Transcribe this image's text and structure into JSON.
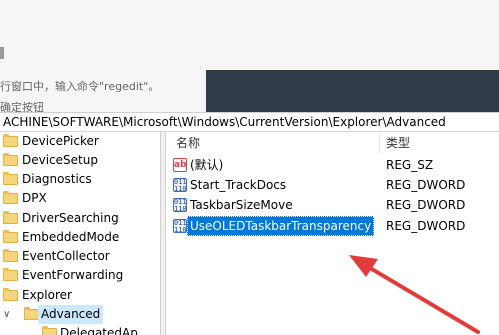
{
  "background": {
    "line1": "行窗口中，输入命令\"regedit\"。",
    "line2": "确定按钮"
  },
  "address_bar": {
    "path": "ACHINE\\SOFTWARE\\Microsoft\\Windows\\CurrentVersion\\Explorer\\Advanced"
  },
  "tree": {
    "items": [
      {
        "label": "DevicePicker"
      },
      {
        "label": "DeviceSetup"
      },
      {
        "label": "Diagnostics"
      },
      {
        "label": "DPX"
      },
      {
        "label": "DriverSearching"
      },
      {
        "label": "EmbeddedMode"
      },
      {
        "label": "EventCollector"
      },
      {
        "label": "EventForwarding"
      },
      {
        "label": "Explorer"
      }
    ],
    "selected": {
      "caret": "∨",
      "label": "Advanced"
    },
    "child": {
      "label": "DelegatedAp..."
    }
  },
  "list": {
    "headers": {
      "name": "名称",
      "type": "类型"
    },
    "rows": [
      {
        "icon": "string-value-icon",
        "icon_text": "ab",
        "name": "(默认)",
        "type": "REG_SZ"
      },
      {
        "icon": "dword-value-icon",
        "icon_text": "011\n110",
        "name": "Start_TrackDocs",
        "type": "REG_DWORD"
      },
      {
        "icon": "dword-value-icon",
        "icon_text": "011\n110",
        "name": "TaskbarSizeMove",
        "type": "REG_DWORD"
      },
      {
        "icon": "dword-value-icon",
        "icon_text": "011\n110",
        "name": "UseOLEDTaskbarTransparency",
        "type": "REG_DWORD"
      }
    ]
  },
  "annotation": {
    "color": "#e23b3b",
    "icon": "red-arrow"
  },
  "colors": {
    "selection": "#0078d7",
    "tree_selection": "#cce8ff"
  }
}
